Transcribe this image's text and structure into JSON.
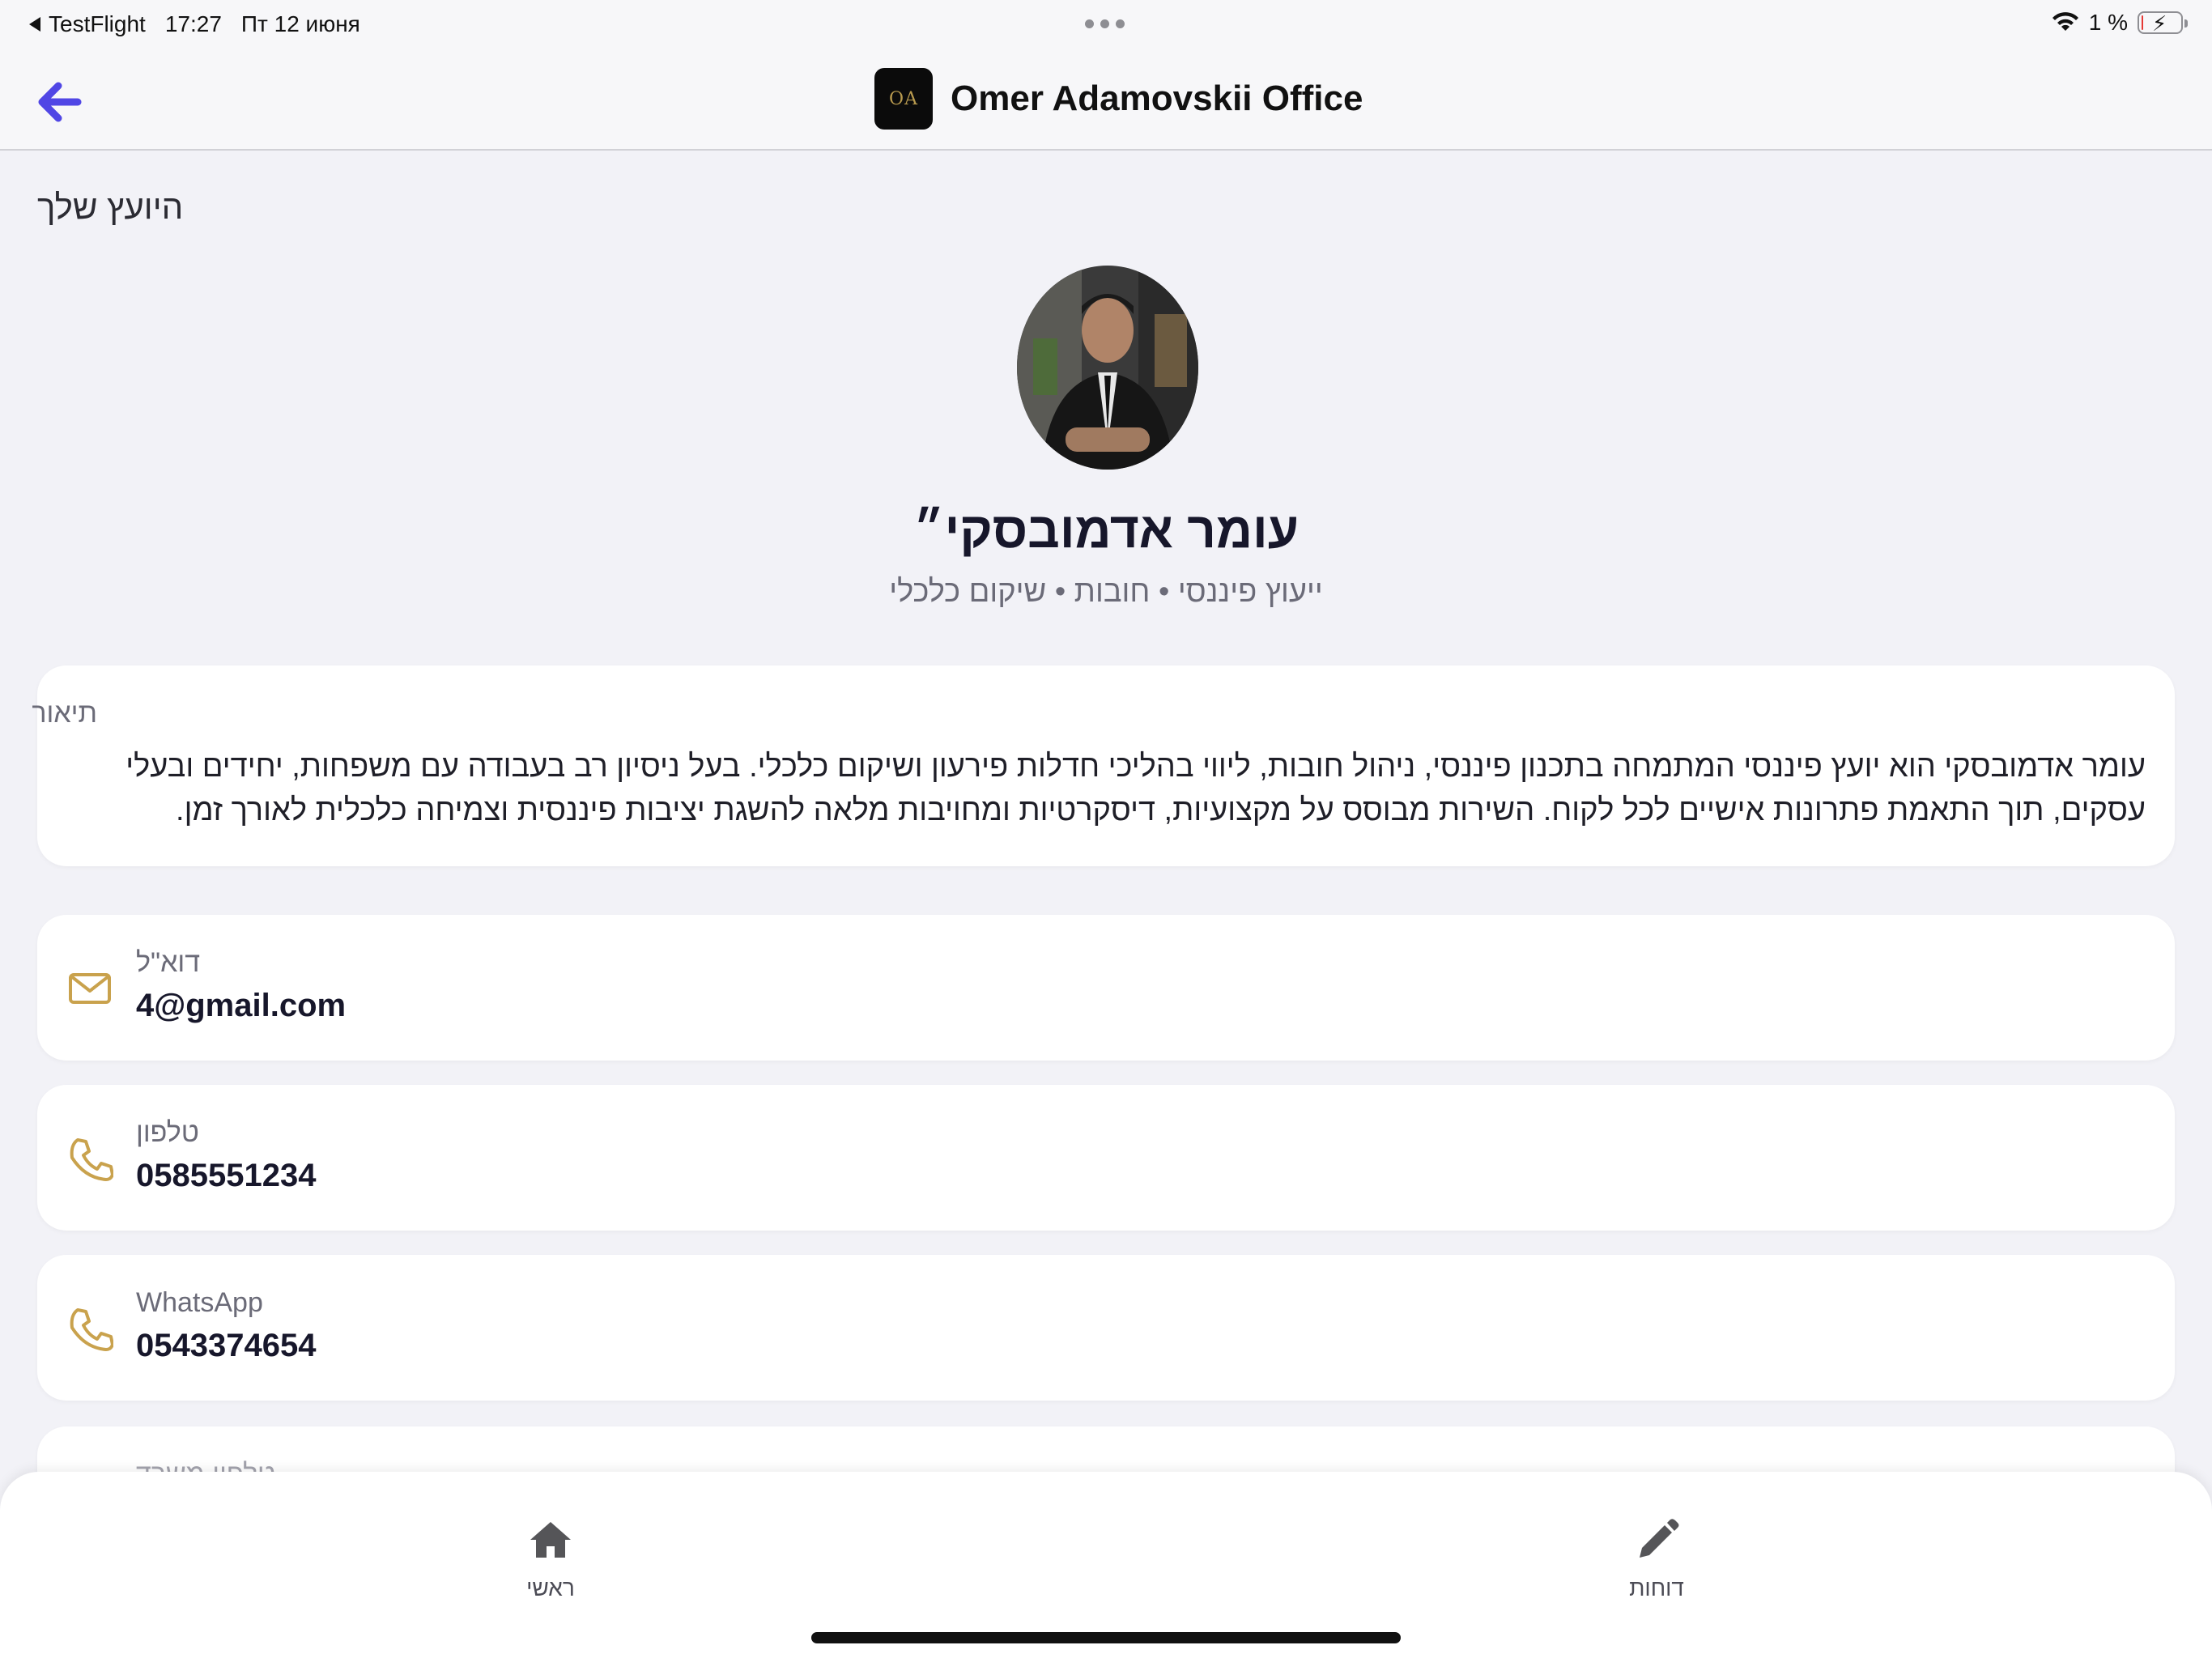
{
  "status_bar": {
    "back_app": "TestFlight",
    "time": "17:27",
    "date": "Пт 12 июня",
    "battery": "1 %",
    "battery_level": 0.01,
    "battery_color": "#e53935"
  },
  "nav": {
    "back_icon": "arrow-left-icon",
    "logo_text": "OA",
    "title": "Omer Adamovskii Office",
    "accent_color": "#5046e5"
  },
  "profile": {
    "section_title": "היועץ שלך",
    "name": "עומר אדמובסקי״",
    "subtitle": "ייעוץ פיננסי • חובות • שיקום כלכלי"
  },
  "description": {
    "label": "תיאור",
    "text": "עומר אדמובסקי הוא יועץ פיננסי המתמחה בתכנון פיננסי, ניהול חובות, ליווי בהליכי חדלות פירעון ושיקום כלכלי. בעל ניסיון רב בעבודה עם משפחות, יחידים ובעלי עסקים, תוך התאמת פתרונות אישיים לכל לקוח. השירות מבוסס על מקצועיות, דיסקרטיות ומחויבות מלאה להשגת יציבות פיננסית וצמיחה כלכלית לאורך זמן."
  },
  "contacts": [
    {
      "icon": "mail-icon",
      "label": "דוא\"ל",
      "value": "4@gmail.com"
    },
    {
      "icon": "phone-icon",
      "label": "טלפון",
      "value": "0585551234"
    },
    {
      "icon": "phone-icon",
      "label": "WhatsApp",
      "value": "0543374654"
    },
    {
      "icon": "phone-icon",
      "label": "טלפון משרד",
      "value": ""
    }
  ],
  "icon_color": "#c9a24d",
  "tabbar": {
    "home_label": "ראשי",
    "reports_label": "דוחות"
  }
}
